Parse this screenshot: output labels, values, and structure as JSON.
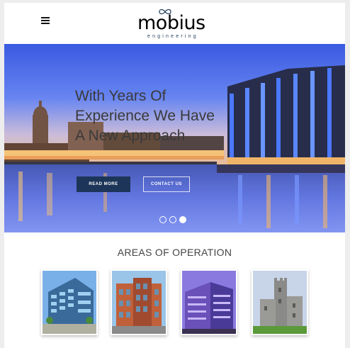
{
  "header": {
    "menu_icon": "hamburger-icon",
    "logo": {
      "word": "mobius",
      "tagline": "engineering"
    }
  },
  "hero": {
    "title": "With Years Of Experience We Have A New Approach",
    "read_more": "READ MORE",
    "contact_us": "CONTACT US",
    "slides_count": 3,
    "active_slide": 3
  },
  "section": {
    "title": "AREAS OF OPERATION"
  },
  "cards": [
    {
      "name": "glass-office-building"
    },
    {
      "name": "brick-apartment-building"
    },
    {
      "name": "purple-modern-building"
    },
    {
      "name": "stone-castle"
    }
  ],
  "colors": {
    "brand_navy": "#1c3558",
    "logo_blue": "#1f3e5c"
  }
}
